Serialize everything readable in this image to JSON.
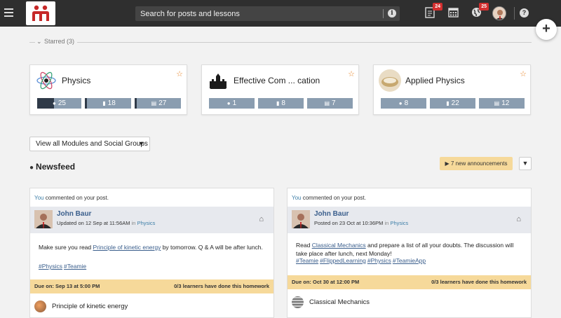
{
  "topbar": {
    "search_placeholder": "Search for posts and lessons",
    "notifications_badge": "24",
    "globe_badge": "25"
  },
  "starred": {
    "label": "Starred (3)",
    "cards": [
      {
        "title": "Physics",
        "stats": [
          "25",
          "18",
          "27"
        ]
      },
      {
        "title": "Effective Com ... cation",
        "stats": [
          "1",
          "8",
          "7"
        ]
      },
      {
        "title": "Applied Physics",
        "stats": [
          "8",
          "22",
          "12"
        ]
      }
    ]
  },
  "view_all_label": "View all Modules and Social Groups",
  "newsfeed_title": "Newsfeed",
  "announcements_label": "7 new announcements",
  "posts": [
    {
      "you": "You",
      "action": " commented on your post.",
      "author": "John Baur",
      "meta": "Updated on 12 Sep at 11:56AM",
      "in": "in",
      "group": "Physics",
      "body_pre": "Make sure you read ",
      "body_link": "Principle of kinetic energy",
      "body_post": "  by tomorrow. Q & A will be after lunch.",
      "tags": [
        "#Physics",
        "#Teamie"
      ],
      "due_left": "Due on: Sep 13 at 5:00 PM",
      "due_right": "0/3 learners have done this homework",
      "lesson": "Principle of kinetic energy"
    },
    {
      "you": "You",
      "action": " commented on your post.",
      "author": "John Baur",
      "meta": "Posted on 23 Oct at 10:36PM",
      "in": "in",
      "group": "Physics",
      "body_pre": "Read ",
      "body_link": "Classical Mechanics",
      "body_post": " and prepare a list of all your doubts. The discussion will take place after lunch, next Monday!",
      "tags": [
        "#Teamie",
        "#FlippedLearning",
        "#Physics",
        "#TeamieApp"
      ],
      "due_left": "Due on: Oct 30 at 12:00 PM",
      "due_right": "0/3 learners have done this homework",
      "lesson": "Classical Mechanics"
    }
  ]
}
